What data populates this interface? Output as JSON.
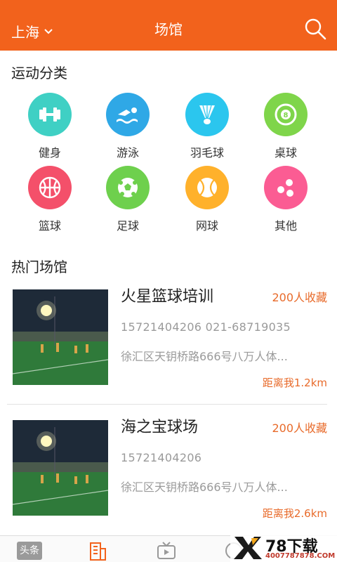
{
  "header": {
    "city": "上海",
    "title": "场馆"
  },
  "sports": {
    "title": "运动分类",
    "items": [
      {
        "label": "健身",
        "icon": "dumbbell-icon",
        "color": "#3fd0c4"
      },
      {
        "label": "游泳",
        "icon": "swimmer-icon",
        "color": "#2fa8e6"
      },
      {
        "label": "羽毛球",
        "icon": "shuttlecock-icon",
        "color": "#2bc6ee"
      },
      {
        "label": "桌球",
        "icon": "billiard-ball-icon",
        "color": "#7fd54a"
      },
      {
        "label": "篮球",
        "icon": "basketball-icon",
        "color": "#f4506a"
      },
      {
        "label": "足球",
        "icon": "soccer-ball-icon",
        "color": "#6ed04d"
      },
      {
        "label": "网球",
        "icon": "tennis-ball-icon",
        "color": "#ffb12b"
      },
      {
        "label": "其他",
        "icon": "dots-icon",
        "color": "#fb5c93"
      }
    ]
  },
  "hot": {
    "title": "热门场馆",
    "venues": [
      {
        "name": "火星篮球培训",
        "favorites": "200人收藏",
        "phone": "15721404206  021-68719035",
        "address": "徐汇区天钥桥路666号八万人体...",
        "distance": "距离我1.2km"
      },
      {
        "name": "海之宝球场",
        "favorites": "200人收藏",
        "phone": "15721404206",
        "address": "徐汇区天钥桥路666号八万人体...",
        "distance": "距离我2.6km"
      }
    ]
  },
  "tabbar": {
    "tab1": "头条",
    "watermark": "78下载",
    "watermark_url": "4007787878.COM"
  }
}
